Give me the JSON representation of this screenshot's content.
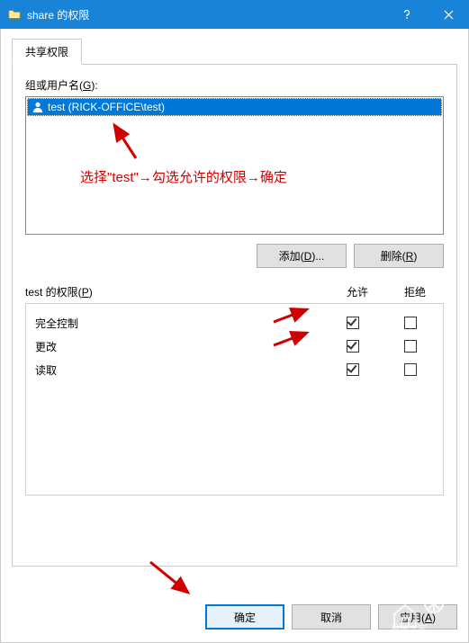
{
  "titlebar": {
    "title": "share 的权限"
  },
  "tab": {
    "label": "共享权限"
  },
  "groupLabel_pre": "组或用户名(",
  "groupLabel_u": "G",
  "groupLabel_post": "):",
  "userItem": "test (RICK-OFFICE\\test)",
  "buttons": {
    "add_pre": "添加(",
    "add_u": "D",
    "add_post": ")...",
    "remove_pre": "删除(",
    "remove_u": "R",
    "remove_post": ")",
    "ok": "确定",
    "cancel": "取消",
    "apply": "应用(",
    "apply_u": "A",
    "apply_post": ")"
  },
  "permHeader_pre": "test 的权限(",
  "permHeader_u": "P",
  "permHeader_post": ")",
  "cols": {
    "allow": "允许",
    "deny": "拒绝"
  },
  "perms": [
    {
      "name": "完全控制",
      "allow": true,
      "deny": false
    },
    {
      "name": "更改",
      "allow": true,
      "deny": false
    },
    {
      "name": "读取",
      "allow": true,
      "deny": false
    }
  ],
  "annotation": "选择\"test\"→勾选允许的权限→确定"
}
